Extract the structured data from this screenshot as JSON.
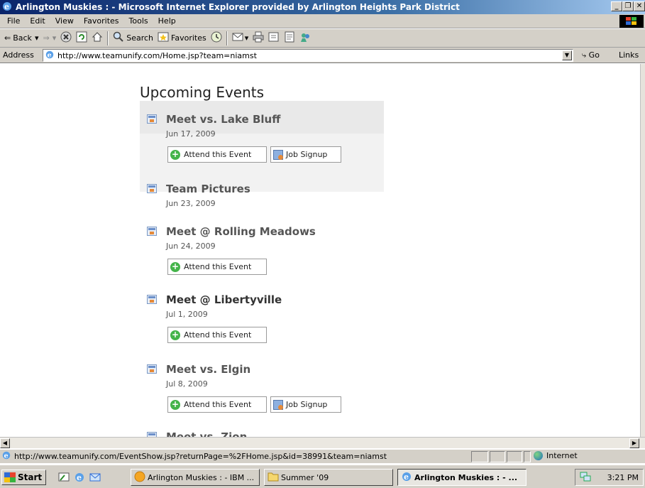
{
  "window": {
    "title": "Arlington Muskies : - Microsoft Internet Explorer provided by Arlington Heights Park District"
  },
  "menu": [
    "File",
    "Edit",
    "View",
    "Favorites",
    "Tools",
    "Help"
  ],
  "toolbar": {
    "back_label": "Back",
    "search_label": "Search",
    "favorites_label": "Favorites"
  },
  "address": {
    "label": "Address",
    "url": "http://www.teamunify.com/Home.jsp?team=niamst",
    "go_label": "Go",
    "links_label": "Links"
  },
  "page": {
    "heading": "Upcoming Events",
    "events": [
      {
        "title": "Meet vs. Lake Bluff",
        "date": "Jun 17, 2009",
        "attend_label": "Attend this Event",
        "job_label": "Job Signup"
      },
      {
        "title": "Team Pictures",
        "date": "Jun 23, 2009"
      },
      {
        "title": "Meet @ Rolling Meadows",
        "date": "Jun 24, 2009",
        "attend_label": "Attend this Event"
      },
      {
        "title": "Meet @ Libertyville",
        "date": "Jul 1, 2009",
        "attend_label": "Attend this Event"
      },
      {
        "title": "Meet vs. Elgin",
        "date": "Jul 8, 2009",
        "attend_label": "Attend this Event",
        "job_label": "Job Signup"
      },
      {
        "title": "Meet vs. Zion"
      }
    ]
  },
  "status": {
    "url": "http://www.teamunify.com/EventShow.jsp?returnPage=%2FHome.jsp&id=38991&team=niamst",
    "zone": "Internet"
  },
  "taskbar": {
    "start_label": "Start",
    "tasks": [
      "Arlington Muskies : - IBM ...",
      "Summer '09",
      "Arlington Muskies : - ..."
    ],
    "clock": "3:21 PM"
  },
  "colors": {
    "titlebar": "#0a246a",
    "chrome": "#d4d0c8",
    "event_highlight": "#f2f2f2",
    "attend_icon": "#44b44a"
  }
}
